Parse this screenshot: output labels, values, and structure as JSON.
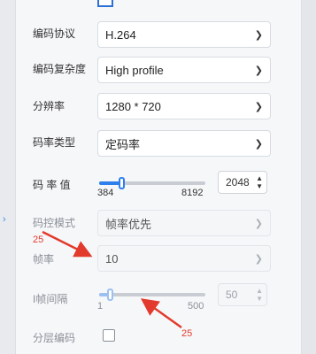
{
  "form": {
    "codec": {
      "label": "编码协议",
      "value": "H.264"
    },
    "complexity": {
      "label": "编码复杂度",
      "value": "High profile"
    },
    "resolution": {
      "label": "分辨率",
      "value": "1280 * 720"
    },
    "rate_type": {
      "label": "码率类型",
      "value": "定码率"
    },
    "bitrate": {
      "label": "码 率 值",
      "min_label": "384",
      "max_label": "8192",
      "value": "2048",
      "fraction": 0.21
    },
    "rate_control": {
      "label": "码控模式",
      "value": "帧率优先"
    },
    "framerate": {
      "label": "帧率",
      "value": "10"
    },
    "iframe_interval": {
      "label": "I帧间隔",
      "min_label": "1",
      "max_label": "500",
      "value": "50",
      "fraction": 0.1
    },
    "layered": {
      "label": "分层编码",
      "checked": false
    }
  },
  "annotations": {
    "top_note": "25",
    "bottom_note": "25",
    "color": "#e23b2d"
  },
  "icons": {
    "chevron": "chevron-down-icon",
    "spin": "spin-arrows-icon",
    "side": "chevron-right-icon"
  }
}
